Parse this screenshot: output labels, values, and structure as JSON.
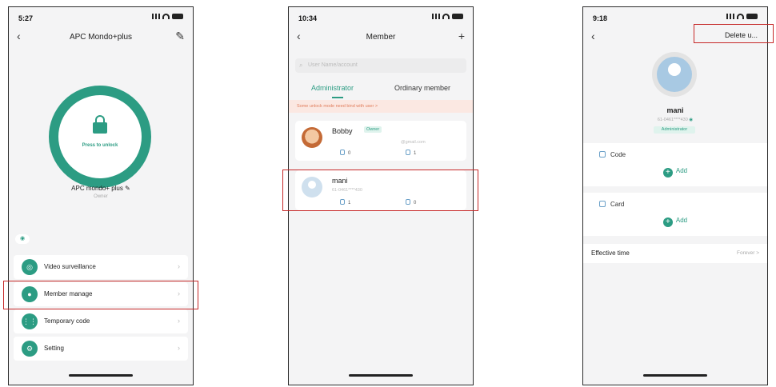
{
  "colors": {
    "accent": "#2c9c83",
    "highlight": "#c62828",
    "notice_bg": "#fbe8e2",
    "notice_text": "#e07d5c"
  },
  "phone1": {
    "status_time": "5:27",
    "title": "APC Mondo+plus",
    "lock_label": "Press to unlock",
    "device_name": "APC mondo+ plus",
    "device_role": "Owner",
    "menu": [
      {
        "label": "Video surveillance",
        "icon": "camera-icon"
      },
      {
        "label": "Member manage",
        "icon": "person-icon"
      },
      {
        "label": "Temporary code",
        "icon": "keypad-icon"
      },
      {
        "label": "Setting",
        "icon": "gear-icon"
      }
    ]
  },
  "phone2": {
    "status_time": "10:34",
    "title": "Member",
    "search_placeholder": "User Name/account",
    "tabs": [
      "Administrator",
      "Ordinary member"
    ],
    "notice": "Some unlock mode need bind with user >",
    "members": [
      {
        "name": "Bobby",
        "badge": "Owner",
        "sub": "@gmail.com",
        "code_count": "0",
        "card_count": "1"
      },
      {
        "name": "mani",
        "badge": "",
        "sub": "61-0461****430",
        "code_count": "1",
        "card_count": "0"
      }
    ]
  },
  "phone3": {
    "status_time": "9:18",
    "delete_label": "Delete u...",
    "name": "mani",
    "phone": "61-0461****430",
    "role": "Administrator",
    "sections": [
      {
        "label": "Code",
        "add_label": "Add"
      },
      {
        "label": "Card",
        "add_label": "Add"
      }
    ],
    "effective_time_label": "Effective time",
    "effective_time_value": "Forever >"
  }
}
